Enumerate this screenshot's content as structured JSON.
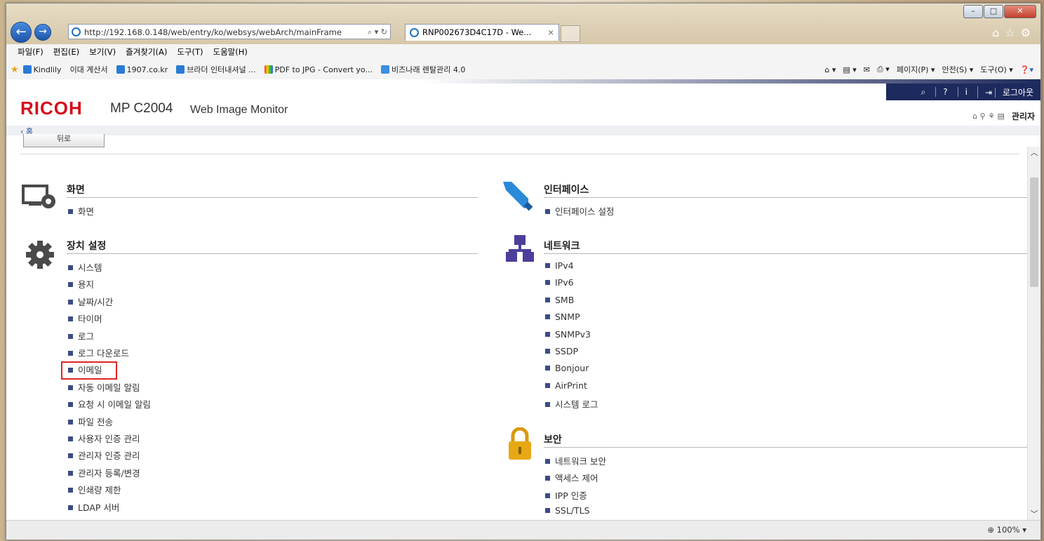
{
  "browser": {
    "address": "http://192.168.0.148/web/entry/ko/websys/webArch/mainFrame",
    "tab_title": "RNP002673D4C17D - We...",
    "tab_close": "×",
    "menu": [
      "파일(F)",
      "편집(E)",
      "보기(V)",
      "즐겨찾기(A)",
      "도구(T)",
      "도움말(H)"
    ],
    "favorites": [
      "Kindlily",
      "이대 계산서",
      "1907.co.kr",
      "브라더 인터내셔널 ...",
      "PDF to JPG - Convert yo...",
      "비즈나래 렌탈관리 4.0"
    ],
    "commands": [
      "페이지(P) ▾",
      "안전(S) ▾",
      "도구(O) ▾"
    ],
    "zoom": "100%"
  },
  "header": {
    "brand": "RICOH",
    "model": "MP C2004",
    "subtitle": "Web Image Monitor",
    "logout": "로그아웃",
    "user": "관리자",
    "breadcrumb": "‹ 홈",
    "back_button": "뒤로"
  },
  "sections": {
    "screen": {
      "title": "화면",
      "items": [
        "화면"
      ]
    },
    "device": {
      "title": "장치 설정",
      "items": [
        "시스템",
        "용지",
        "날짜/시간",
        "타이머",
        "로그",
        "로그 다운로드",
        "이메일",
        "자동 이메일 알림",
        "요청 시 이메일 알림",
        "파일 전송",
        "사용자 인증 관리",
        "관리자 인증 관리",
        "관리자 등록/변경",
        "인쇄량 제한",
        "LDAP 서버"
      ]
    },
    "interface": {
      "title": "인터페이스",
      "items": [
        "인터페이스 설정"
      ]
    },
    "network": {
      "title": "네트워크",
      "items": [
        "IPv4",
        "IPv6",
        "SMB",
        "SNMP",
        "SNMPv3",
        "SSDP",
        "Bonjour",
        "AirPrint",
        "시스템 로그"
      ]
    },
    "security": {
      "title": "보안",
      "items": [
        "네트워크 보안",
        "액세스 제어",
        "IPP 인증",
        "SSL/TLS"
      ]
    }
  },
  "colors": {
    "brand_red": "#d4101c",
    "nav_dark": "#1d2a5e",
    "bullet": "#3a4c86",
    "highlight": "#e02424"
  }
}
